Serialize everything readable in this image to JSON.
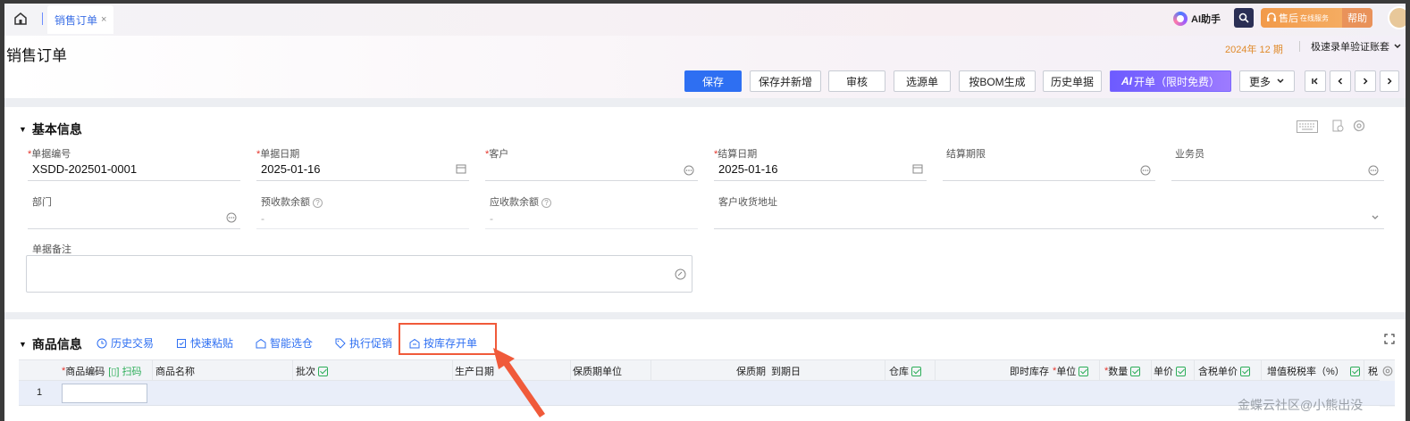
{
  "topbar": {
    "tab_label": "销售订单",
    "tab_close": "×",
    "ai_assistant": "AI助手",
    "service_label": "售后",
    "service_sub": "在线服务",
    "help_label": "帮助"
  },
  "header": {
    "page_title": "销售订单",
    "period": "2024年 12 期",
    "ledger_name": "极速录单验证账套"
  },
  "toolbar": {
    "save": "保存",
    "save_new": "保存并新增",
    "audit": "审核",
    "select_source": "选源单",
    "by_bom": "按BOM生成",
    "history": "历史单据",
    "ai_open": "开单（限时免费）",
    "ai_mark": "AI",
    "more": "更多"
  },
  "basic": {
    "title": "基本信息",
    "fields": {
      "doc_no_label": "单据编号",
      "doc_no_value": "XSDD-202501-0001",
      "doc_date_label": "单据日期",
      "doc_date_value": "2025-01-16",
      "customer_label": "客户",
      "settle_date_label": "结算日期",
      "settle_date_value": "2025-01-16",
      "settle_term_label": "结算期限",
      "salesman_label": "业务员",
      "dept_label": "部门",
      "prepay_label": "预收款余额",
      "prepay_value": "-",
      "receivable_label": "应收款余额",
      "receivable_value": "-",
      "address_label": "客户收货地址",
      "remark_label": "单据备注"
    }
  },
  "goods": {
    "title": "商品信息",
    "tools": [
      "历史交易",
      "快速粘贴",
      "智能选仓",
      "执行促销",
      "按库存开单"
    ],
    "columns": {
      "code": "商品编码",
      "scan": "扫码",
      "name": "商品名称",
      "batch": "批次",
      "prod_date": "生产日期",
      "shelf_unit": "保质期单位",
      "shelf_life": "保质期",
      "expire": "到期日",
      "warehouse": "仓库",
      "stock": "即时库存",
      "unit": "单位",
      "qty": "数量",
      "price": "单价",
      "tax_price": "含税单价",
      "tax_rate": "增值税税率（%）",
      "tax_short": "税"
    },
    "rows": [
      {
        "no": "1"
      }
    ]
  },
  "watermark": "金蝶云社区@小熊出没",
  "colors": {
    "primary": "#2e6ff2",
    "required": "#e5342a",
    "highlight": "#f05a3a",
    "period": "#e08a2a"
  }
}
